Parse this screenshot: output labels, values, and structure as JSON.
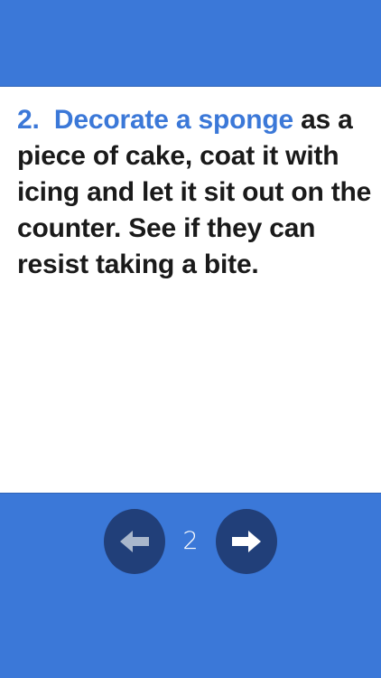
{
  "tip": {
    "number": "2.",
    "highlight": "Decorate a sponge",
    "body": " as a piece of cake, coat it with icing and let it sit out on the counter.  See if they can resist taking a bite."
  },
  "nav": {
    "page_number": "2",
    "prev_icon": "arrow-left-icon",
    "next_icon": "arrow-right-icon"
  },
  "colors": {
    "accent": "#3b78d8",
    "button": "#213f79",
    "text": "#1a1a1a",
    "panel": "#ffffff"
  }
}
